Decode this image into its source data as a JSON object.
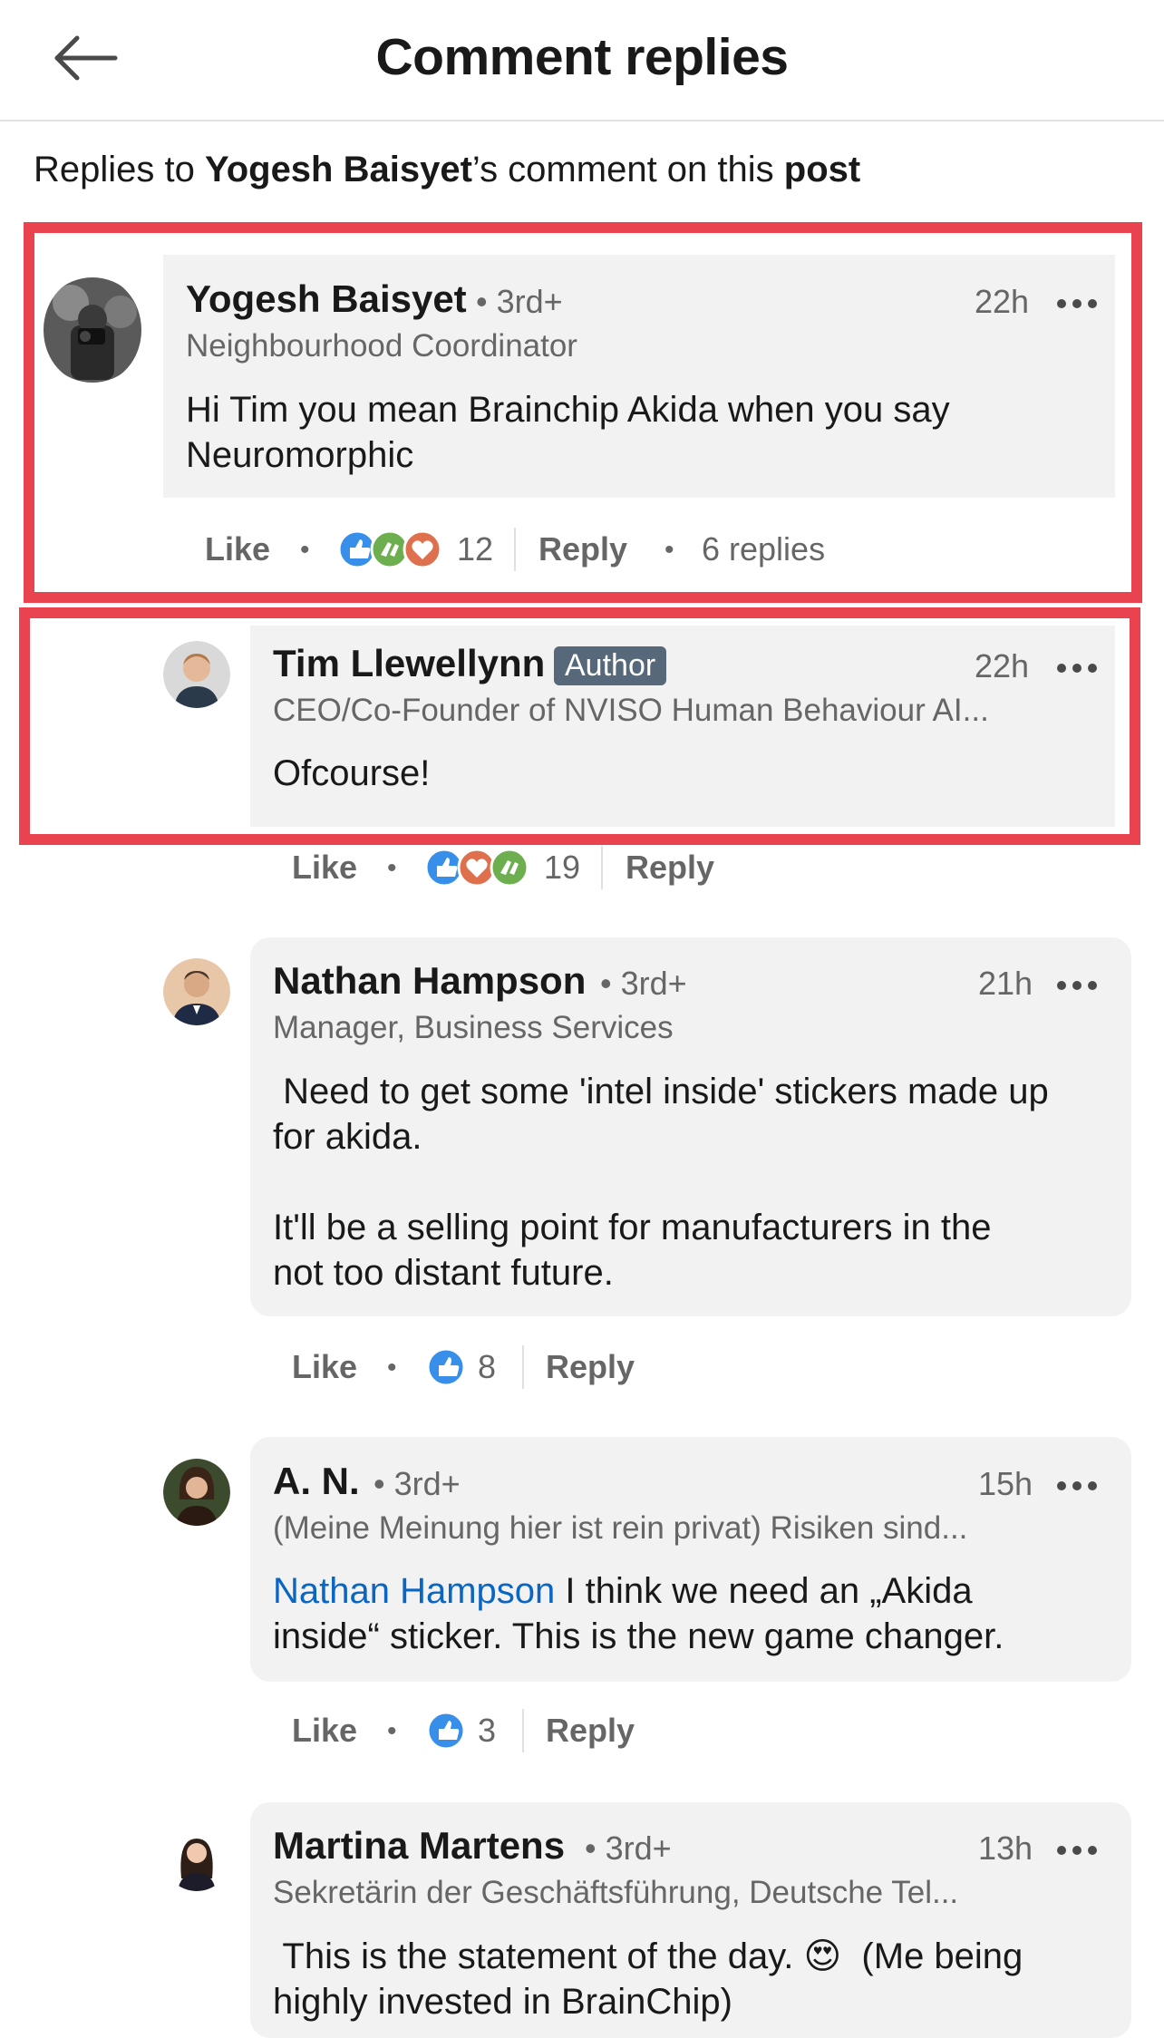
{
  "header": {
    "title": "Comment replies"
  },
  "subhead": {
    "prefix": "Replies to ",
    "author": "Yogesh Baisyet",
    "middle": "’s comment on this ",
    "post": "post"
  },
  "actions": {
    "like": "Like",
    "reply": "Reply"
  },
  "highlight_color": "#e8434f",
  "comments": [
    {
      "name": "Yogesh Baisyet",
      "degree": "• 3rd+",
      "time": "22h",
      "headline": "Neighbourhood Coordinator",
      "text_lines": [
        "Hi Tim you mean Brainchip Akida when you say",
        "Neuromorphic"
      ],
      "reactions": [
        "like-icon",
        "celebrate-icon",
        "love-icon"
      ],
      "reaction_count": "12",
      "replies": "6 replies"
    },
    {
      "name": "Tim Llewellynn",
      "badge": "Author",
      "time": "22h",
      "headline": "CEO/Co-Founder of NVISO Human Behaviour AI...",
      "text": "Ofcourse!",
      "reactions": [
        "like-icon",
        "love-icon",
        "celebrate-icon"
      ],
      "reaction_count": "19"
    },
    {
      "name": "Nathan Hampson",
      "degree": "• 3rd+",
      "time": "21h",
      "headline": "Manager, Business Services",
      "text_lines": [
        " Need to get some 'intel inside' stickers made up",
        "for akida.",
        "",
        "It'll be a selling point for manufacturers in the",
        "not too distant future."
      ],
      "reactions": [
        "like-icon"
      ],
      "reaction_count": "8"
    },
    {
      "name": "A. N.",
      "degree": "• 3rd+",
      "time": "15h",
      "headline": "(Meine Meinung hier ist rein privat) Risiken sind...",
      "mention": "Nathan Hampson",
      "text_line1_rest": " I think we need an „Akida",
      "text_line2": "inside“ sticker. This is the new game changer.",
      "reactions": [
        "like-icon"
      ],
      "reaction_count": "3"
    },
    {
      "name": "Martina Martens",
      "degree": "• 3rd+",
      "time": "13h",
      "headline": "Sekretärin der Geschäftsführung, Deutsche Tel...",
      "text_line1": " This is the statement of the day. ",
      "emoji": "😍",
      "text_line1_end": "  (Me being",
      "text_line2": "highly invested in BrainChip)"
    }
  ]
}
